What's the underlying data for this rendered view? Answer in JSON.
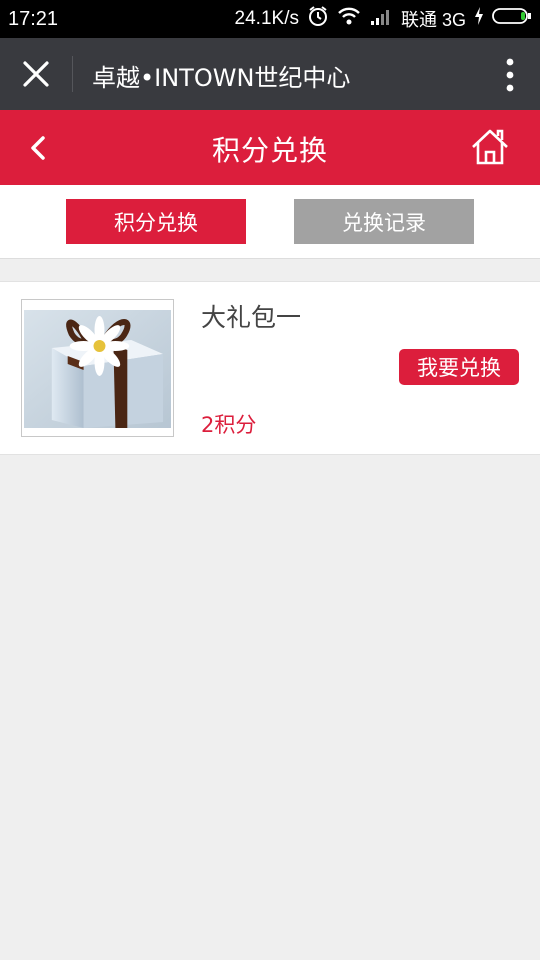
{
  "status": {
    "time": "17:21",
    "speed": "24.1K/s",
    "carrier": "联通 3G"
  },
  "topbar": {
    "title": "卓越•INTOWN世纪中心"
  },
  "header": {
    "title": "积分兑换"
  },
  "tabs": [
    {
      "label": "积分兑换",
      "active": true
    },
    {
      "label": "兑换记录",
      "active": false
    }
  ],
  "items": [
    {
      "name": "大礼包一",
      "points": "2积分",
      "button": "我要兑换"
    }
  ],
  "colors": {
    "accent": "#dc1e3c",
    "topbar": "#393a3f",
    "inactive_tab": "#a2a2a2",
    "page_bg": "#efefef"
  },
  "icons": [
    "close-icon",
    "more-icon",
    "back-icon",
    "home-icon",
    "alarm-icon",
    "wifi-icon",
    "signal-icon",
    "battery-icon"
  ]
}
